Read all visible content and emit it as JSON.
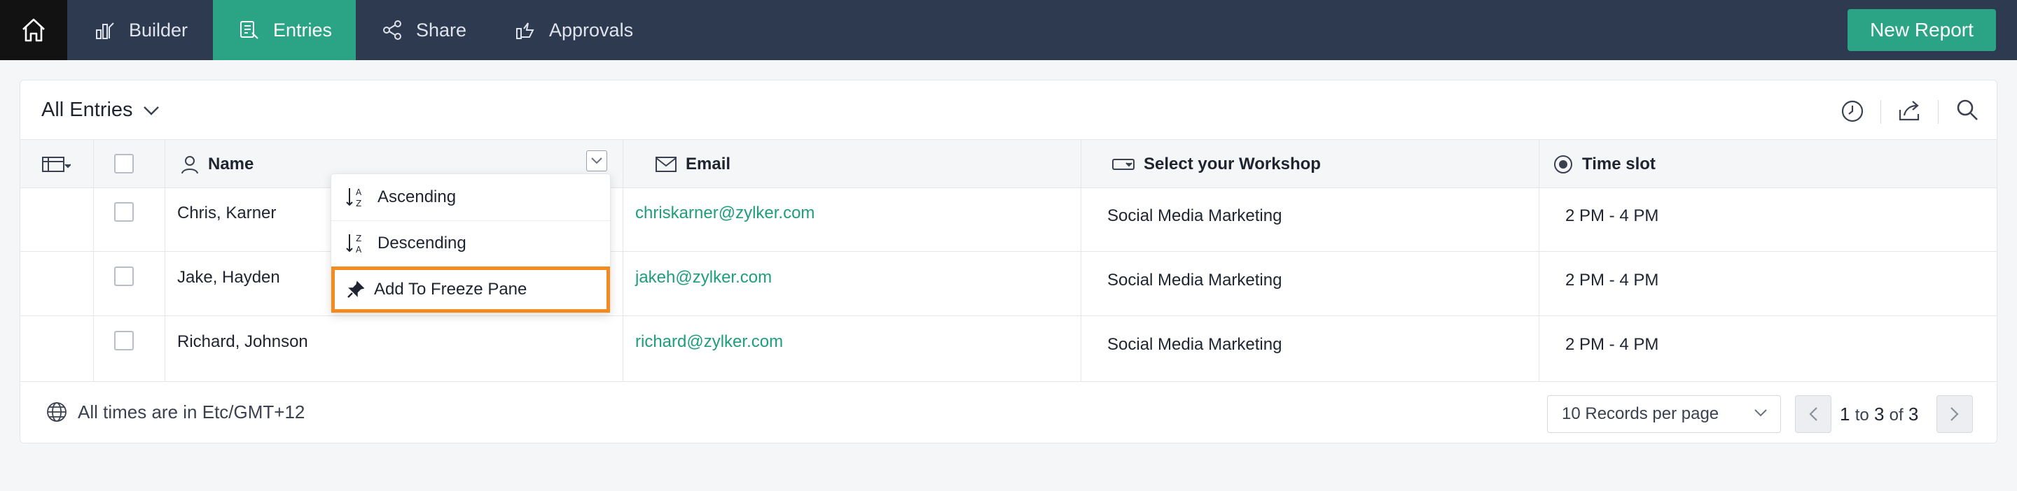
{
  "nav": {
    "items": [
      {
        "label": "Builder",
        "icon": "builder-icon"
      },
      {
        "label": "Entries",
        "icon": "entries-icon",
        "active": true
      },
      {
        "label": "Share",
        "icon": "share-icon"
      },
      {
        "label": "Approvals",
        "icon": "approvals-icon"
      }
    ],
    "new_report_label": "New Report"
  },
  "report": {
    "title": "All Entries"
  },
  "table": {
    "columns": [
      {
        "label": "Name",
        "icon": "person-icon"
      },
      {
        "label": "Email",
        "icon": "mail-icon"
      },
      {
        "label": "Select your Workshop",
        "icon": "dropdown-field-icon"
      },
      {
        "label": "Time slot",
        "icon": "radio-icon"
      }
    ],
    "rows": [
      {
        "name": "Chris, Karner",
        "email": "chriskarner@zylker.com",
        "workshop": "Social Media Marketing",
        "time": "2 PM - 4 PM"
      },
      {
        "name": "Jake, Hayden",
        "email": "jakeh@zylker.com",
        "workshop": "Social Media Marketing",
        "time": "2 PM - 4 PM"
      },
      {
        "name": "Richard, Johnson",
        "email": "richard@zylker.com",
        "workshop": "Social Media Marketing",
        "time": "2 PM - 4 PM"
      }
    ]
  },
  "sort_menu": {
    "items": [
      {
        "label": "Ascending",
        "icon": "sort-ascending-icon"
      },
      {
        "label": "Descending",
        "icon": "sort-descending-icon"
      },
      {
        "label": "Add To Freeze Pane",
        "icon": "pin-icon",
        "highlighted": true
      }
    ]
  },
  "footer": {
    "timezone_text": "All times are in Etc/GMT+12",
    "per_page": "10 Records per page",
    "pagination": {
      "from": "1",
      "to_word": "to",
      "to": "3",
      "of_word": "of",
      "total": "3"
    }
  },
  "colors": {
    "nav_bg": "#2e3a4f",
    "accent": "#2aa484",
    "highlight": "#f58a1f",
    "link": "#1e9e7d"
  }
}
